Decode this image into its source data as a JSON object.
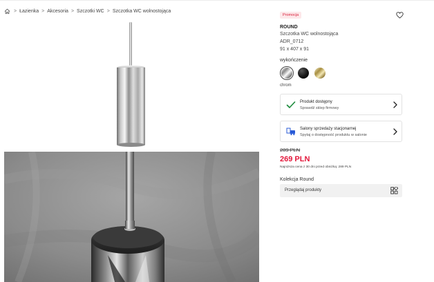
{
  "breadcrumb": {
    "items": [
      "Łazienka",
      "Akcesoria",
      "Szczotki WC",
      "Szczotka WC wolnostojąca"
    ],
    "separator": ">"
  },
  "product": {
    "badge": "Promocja",
    "brand": "ROUND",
    "name": "Szczotka WC wolnostojąca",
    "code": "ADR_0712",
    "dimensions": "91 x 407 x 91"
  },
  "finish": {
    "label": "wykończenie",
    "selected": "chrom",
    "options": [
      {
        "name": "chrom",
        "color": "#c8c8c8"
      },
      {
        "name": "black",
        "color": "#111111"
      },
      {
        "name": "gold",
        "color": "#c9b36a"
      }
    ]
  },
  "availability": {
    "title": "Produkt dostępny",
    "subtitle": "Sprawdź sklep firmowy",
    "icon": "check-icon",
    "icon_color": "#1a8a3a"
  },
  "salons": {
    "title": "Salony sprzedaży stacjonarnej",
    "subtitle": "Spytaj o dostępność produktu w salonie",
    "icon": "store-truck-icon",
    "icon_color": "#2a5bd7"
  },
  "pricing": {
    "old_price": "289 PLN",
    "new_price": "269 PLN",
    "price_color": "#e3163a",
    "lowest_note": "Najniższa cena z 30 dni przed obniżką: 289 PLN"
  },
  "collection": {
    "label": "Kolekcja Round",
    "button": "Przeglądaj produkty",
    "icon": "grid-icon"
  }
}
